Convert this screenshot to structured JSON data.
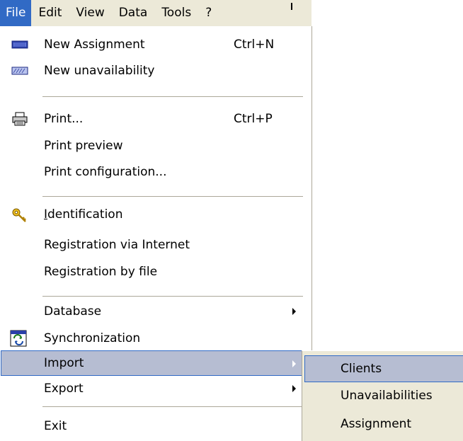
{
  "menubar": {
    "items": [
      {
        "label": "File",
        "active": true
      },
      {
        "label": "Edit"
      },
      {
        "label": "View"
      },
      {
        "label": "Data"
      },
      {
        "label": "Tools"
      },
      {
        "label": "?"
      }
    ]
  },
  "file_menu": {
    "new_assignment": {
      "label": "New Assignment",
      "shortcut": "Ctrl+N"
    },
    "new_unavailability": {
      "label": "New unavailability"
    },
    "print": {
      "label": "Print...",
      "shortcut": "Ctrl+P"
    },
    "print_preview": {
      "label": "Print preview"
    },
    "print_configuration": {
      "label": "Print configuration..."
    },
    "identification": {
      "label_first": "I",
      "label_rest": "dentification"
    },
    "registration_internet": {
      "label": "Registration via Internet"
    },
    "registration_file": {
      "label": "Registration by file"
    },
    "database": {
      "label": "Database"
    },
    "synchronization": {
      "label": "Synchronization"
    },
    "import": {
      "label": "Import"
    },
    "export": {
      "label": "Export"
    },
    "exit": {
      "label": "Exit"
    }
  },
  "import_submenu": {
    "items": [
      {
        "label": "Clients",
        "highlighted": true
      },
      {
        "label": "Unavailabilities"
      },
      {
        "label": "Assignment"
      }
    ]
  },
  "colors": {
    "menubar_bg": "#ece9d8",
    "selection_blue": "#316ac5",
    "highlight_bg": "#b6bdd2"
  },
  "icons": {
    "new_assignment": "assignment-block-icon",
    "new_unavailability": "unavailability-block-icon",
    "print": "printer-icon",
    "identification": "keys-icon",
    "synchronization": "sync-icon"
  }
}
